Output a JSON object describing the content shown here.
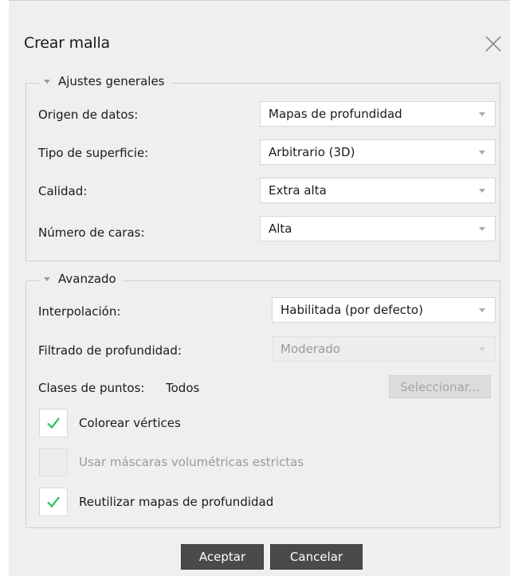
{
  "dialog": {
    "title": "Crear malla",
    "close_icon": "close-icon"
  },
  "general": {
    "header": "Ajustes generales",
    "rows": [
      {
        "label": "Origen de datos:",
        "value": "Mapas de profundidad"
      },
      {
        "label": "Tipo de superficie:",
        "value": "Arbitrario (3D)"
      },
      {
        "label": "Calidad:",
        "value": "Extra alta"
      },
      {
        "label": "Número de caras:",
        "value": "Alta"
      }
    ]
  },
  "advanced": {
    "header": "Avanzado",
    "interpolation": {
      "label": "Interpolación:",
      "value": "Habilitada (por defecto)"
    },
    "depth_filter": {
      "label": "Filtrado de profundidad:",
      "value": "Moderado",
      "disabled": true
    },
    "point_classes": {
      "label": "Clases de puntos:",
      "value": "Todos",
      "button": "Seleccionar..."
    },
    "checkboxes": [
      {
        "label": "Colorear vértices",
        "checked": true,
        "disabled": false
      },
      {
        "label": "Usar máscaras volumétricas estrictas",
        "checked": false,
        "disabled": true
      },
      {
        "label": "Reutilizar mapas de profundidad",
        "checked": true,
        "disabled": false
      }
    ]
  },
  "footer": {
    "ok": "Aceptar",
    "cancel": "Cancelar"
  },
  "colors": {
    "check": "#22c05a",
    "dialog_bg": "#efefef",
    "button_dark": "#4a4a4a"
  }
}
